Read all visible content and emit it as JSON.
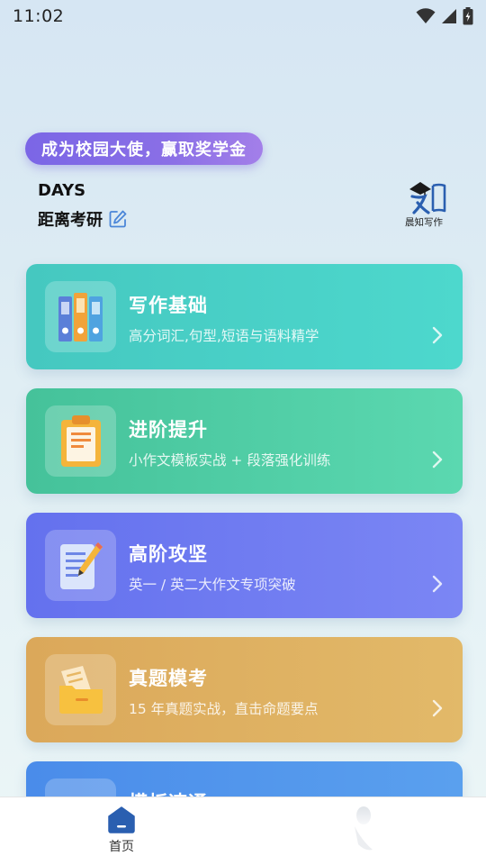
{
  "status_bar": {
    "time": "11:02"
  },
  "banner": {
    "text": "成为校园大使，赢取奖学金"
  },
  "countdown": {
    "days_label": "DAYS",
    "exam_label": "距离考研"
  },
  "logo": {
    "text": "晨知写作"
  },
  "cards": [
    {
      "title": "写作基础",
      "subtitle": "高分词汇,句型,短语与语料精学",
      "icon": "binders-icon"
    },
    {
      "title": "进阶提升",
      "subtitle": "小作文模板实战 + 段落强化训练",
      "icon": "clipboard-icon"
    },
    {
      "title": "高阶攻坚",
      "subtitle": "英一 / 英二大作文专项突破",
      "icon": "document-pencil-icon"
    },
    {
      "title": "真题模考",
      "subtitle": "15 年真题实战，直击命题要点",
      "icon": "folder-icon"
    },
    {
      "title": "模板速通",
      "subtitle": "",
      "icon": "template-icon"
    }
  ],
  "tabbar": {
    "home_label": "首页"
  },
  "colors": {
    "banner": "#7b66e6",
    "card_basic": "#4dd0c6",
    "card_advanced": "#4fcca4",
    "card_high": "#6f7cf1",
    "card_exam": "#dfb264",
    "card_template": "#5096ec",
    "tab_home_icon": "#2a5fb0"
  }
}
